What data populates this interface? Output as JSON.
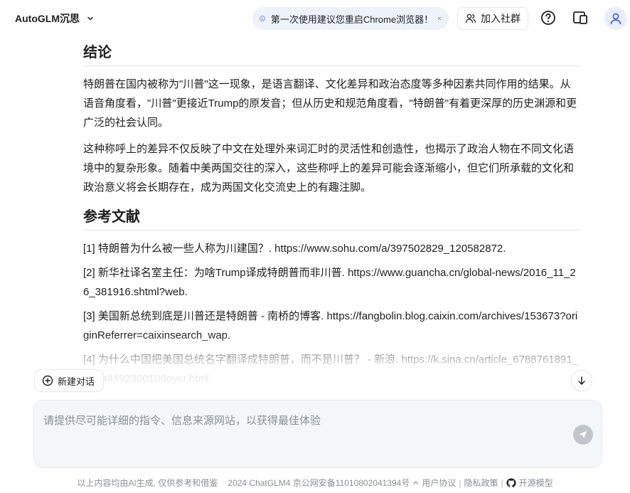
{
  "header": {
    "brand": "AutoGLM沉思",
    "notice": "第一次使用建议您重启Chrome浏览器！",
    "join_label": "加入社群"
  },
  "content": {
    "conclusion_heading": "结论",
    "conclusion_paragraphs": [
      "特朗普在国内被称为\"川普\"这一现象，是语言翻译、文化差异和政治态度等多种因素共同作用的结果。从语音角度看，\"川普\"更接近Trump的原发音；但从历史和规范角度看，\"特朗普\"有着更深厚的历史渊源和更广泛的社会认同。",
      "这种称呼上的差异不仅反映了中文在处理外来词汇时的灵活性和创造性，也揭示了政治人物在不同文化语境中的复杂形象。随着中美两国交往的深入，这些称呼上的差异可能会逐渐缩小，但它们所承载的文化和政治意义将会长期存在，成为两国文化交流史上的有趣注脚。"
    ],
    "references_heading": "参考文献",
    "references": [
      "[1] 特朗普为什么被一些人称为川建国？. https://www.sohu.com/a/397502829_120582872.",
      "[2] 新华社译名室主任：为啥Trump译成特朗普而非川普. https://www.guancha.cn/global-news/2016_11_26_381916.shtml?web.",
      "[3] 美国新总统到底是川普还是特朗普 - 南桥的博客. https://fangbolin.blog.caixin.com/archives/153673?originReferrer=caixinsearch_wap.",
      "[4] 为什么中国把美国总统名字翻译成特朗普，而不是川普？ - 新浪. https://k.sina.cn/article_6788761891_194a4492300100oyiu.html."
    ]
  },
  "new_chat_label": "新建对话",
  "input": {
    "placeholder": "请提供尽可能详细的指令、信息来源网站，以获得最佳体验"
  },
  "footer": {
    "disclaimer": "以上内容均由AI生成, 仅供参考和借鉴",
    "copyright": "2024 ChatGLM4 京公网安备11010802041394号",
    "user_agreement": "用户协议",
    "privacy": "隐私政策",
    "open_source": "开源模型"
  },
  "colors": {
    "accent": "#3b5bdb",
    "notice_bg": "#eef2fb",
    "input_bg": "#f4f6f8"
  }
}
